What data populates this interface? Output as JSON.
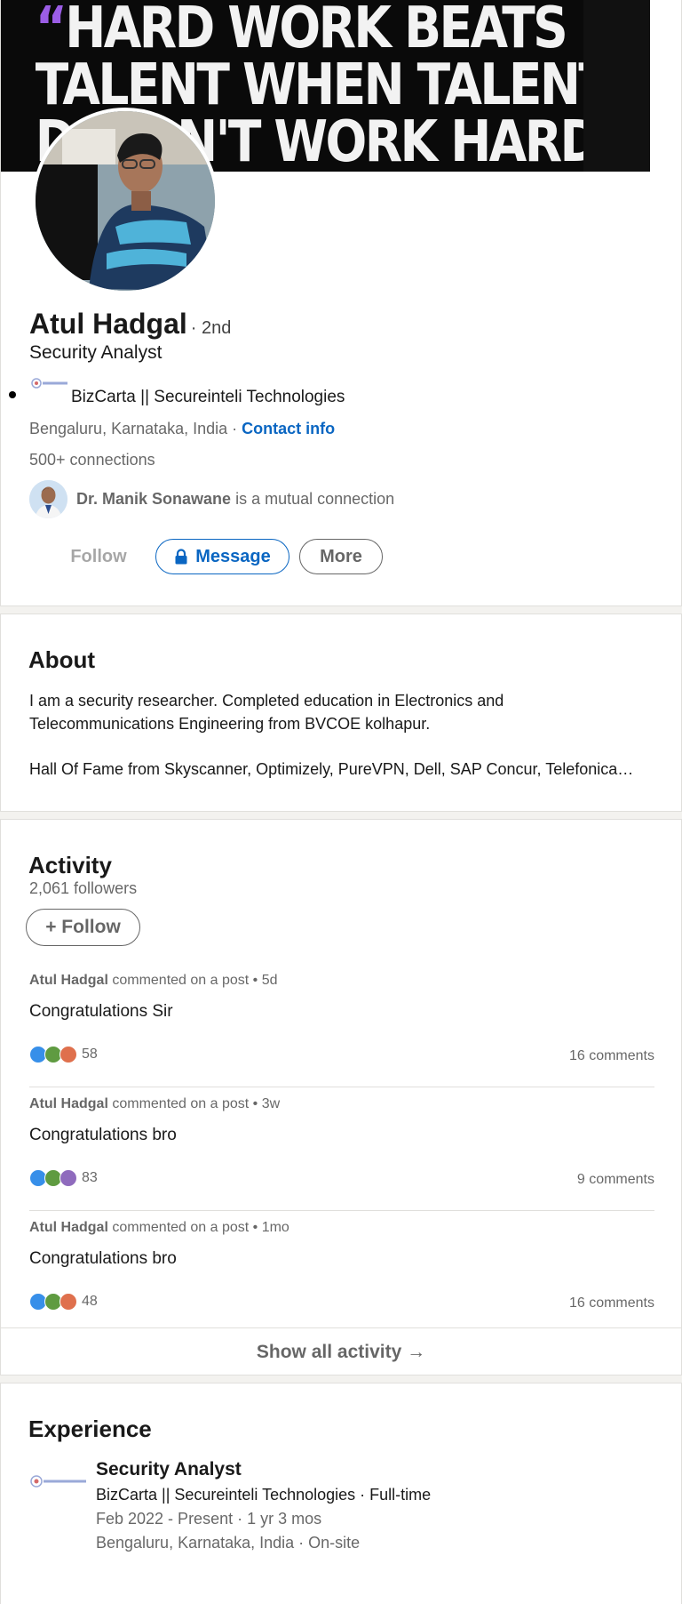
{
  "profile": {
    "banner_lines": [
      "HARD WORK BEATS",
      "TALENT WHEN TALENT",
      "DOESN'T WORK HARD"
    ],
    "banner_quote_open": "“",
    "banner_quote_close": "”",
    "name": "Atul Hadgal",
    "degree": "· 2nd",
    "headline": "Security Analyst",
    "company": "BizCarta || Secureinteli Technologies",
    "location": "Bengaluru, Karnataka, India",
    "location_sep": " · ",
    "contact_info": "Contact info",
    "connections": "500+ connections",
    "mutual_name": "Dr. Manik Sonawane",
    "mutual_suffix": "is a mutual connection",
    "actions": {
      "follow": "Follow",
      "message": "Message",
      "more": "More"
    }
  },
  "about": {
    "title": "About",
    "text": "I am a security researcher. Completed education in Electronics and Telecommunications Engineering from BVCOE kolhapur.",
    "hall_of_fame": "Hall Of Fame from Skyscanner, Optimizely, PureVPN, Dell, SAP Concur, Telefonica…"
  },
  "activity": {
    "title": "Activity",
    "followers": "2,061 followers",
    "follow_button": "+ Follow",
    "posts": [
      {
        "author": "Atul Hadgal",
        "action": "commented on a post • 5d",
        "text": "Congratulations Sir",
        "reactions": "58",
        "comments": "16 comments"
      },
      {
        "author": "Atul Hadgal",
        "action": "commented on a post • 3w",
        "text": "Congratulations bro",
        "reactions": "83",
        "comments": "9 comments"
      },
      {
        "author": "Atul Hadgal",
        "action": "commented on a post • 1mo",
        "text": "Congratulations bro",
        "reactions": "48",
        "comments": "16 comments"
      }
    ],
    "show_all": "Show all activity →"
  },
  "experience": {
    "title": "Experience",
    "items": [
      {
        "title": "Security Analyst",
        "company": "BizCarta || Secureinteli Technologies · Full-time",
        "dates": "Feb 2022 - Present · 1 yr 3 mos",
        "location": "Bengaluru, Karnataka, India · On-site"
      }
    ]
  },
  "colors": {
    "link": "#0a66c2",
    "banner_accent": "#9b5de5"
  },
  "icons": {
    "lock": "lock-icon",
    "like": "like-reaction-icon",
    "celebrate": "celebrate-reaction-icon",
    "love": "love-reaction-icon",
    "insightful": "insightful-reaction-icon"
  }
}
